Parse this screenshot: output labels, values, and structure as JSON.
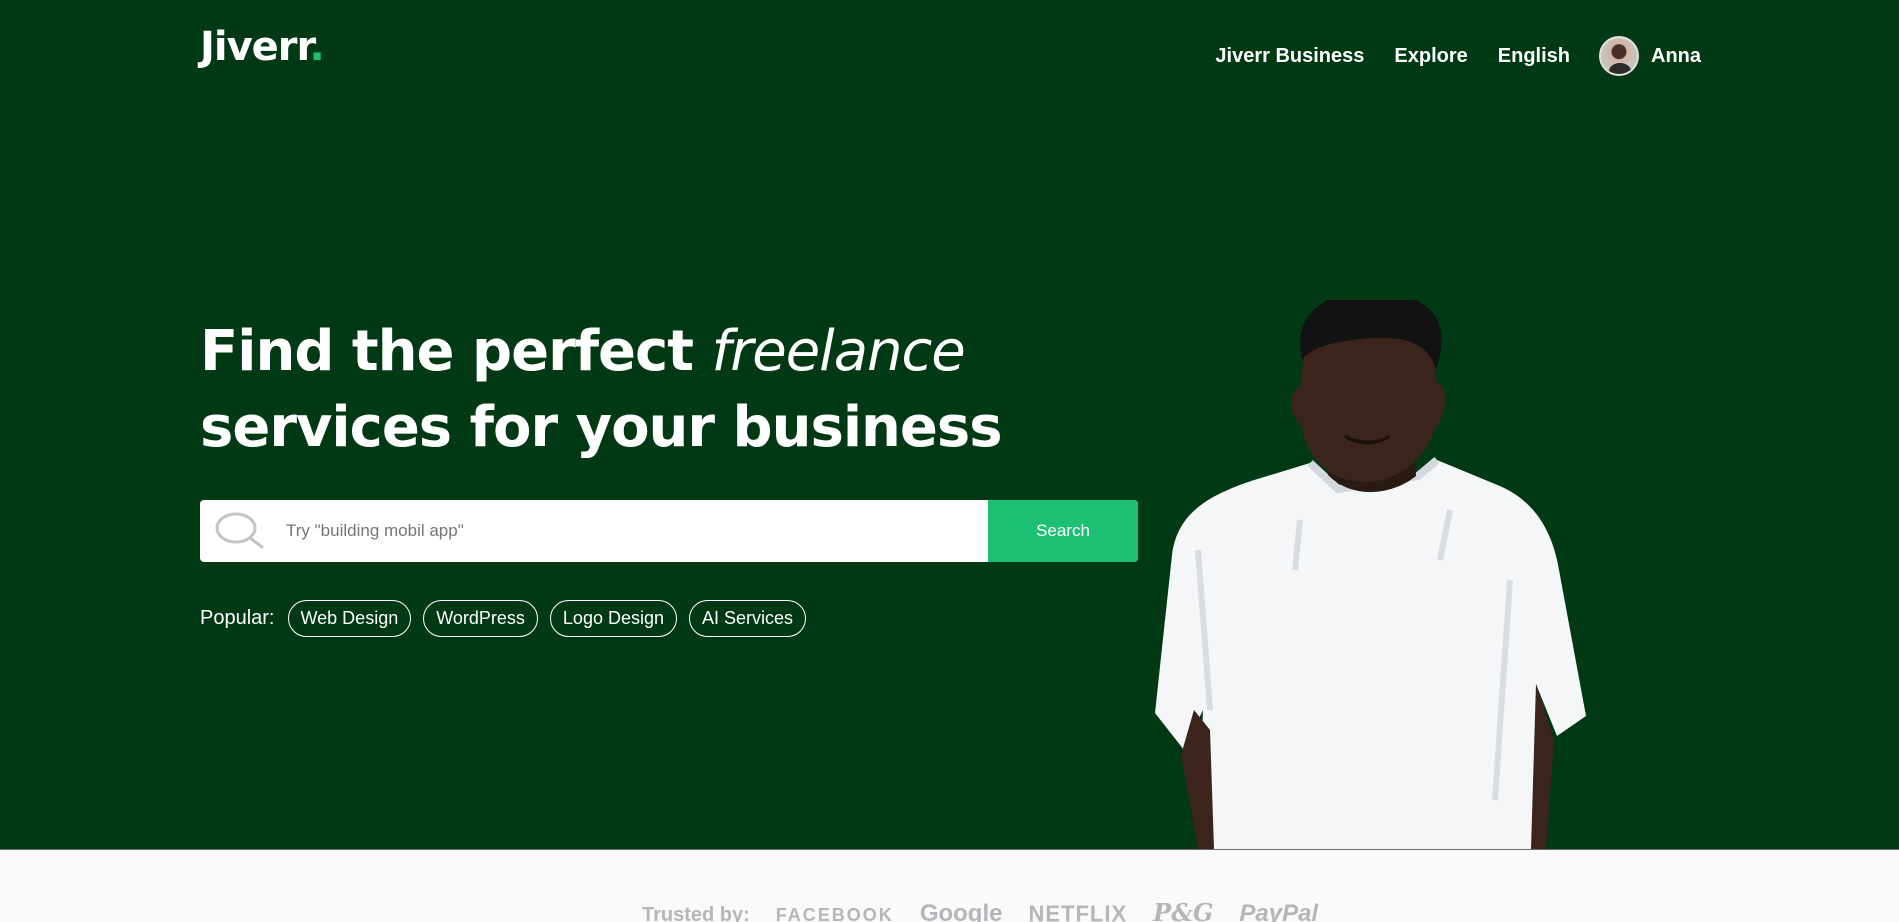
{
  "header": {
    "logo_text": "Jiverr",
    "logo_dot": ".",
    "nav": [
      "Jiverr Business",
      "Explore",
      "English"
    ],
    "user_name": "Anna"
  },
  "hero": {
    "headline_part1": "Find the perfect ",
    "headline_em": "freelance",
    "headline_part2": "services for your business",
    "search_placeholder": "Try \"building mobil app\"",
    "search_button": "Search",
    "popular_label": "Popular:",
    "popular_tags": [
      "Web Design",
      "WordPress",
      "Logo Design",
      "AI Services"
    ]
  },
  "trusted": {
    "label": "Trusted by:",
    "brands": [
      "FACEBOOK",
      "Google",
      "NETFLIX",
      "P&G",
      "PayPal"
    ]
  },
  "colors": {
    "hero_bg": "#013914",
    "accent": "#1dbf73",
    "trusted_text": "#b5b6ba"
  }
}
